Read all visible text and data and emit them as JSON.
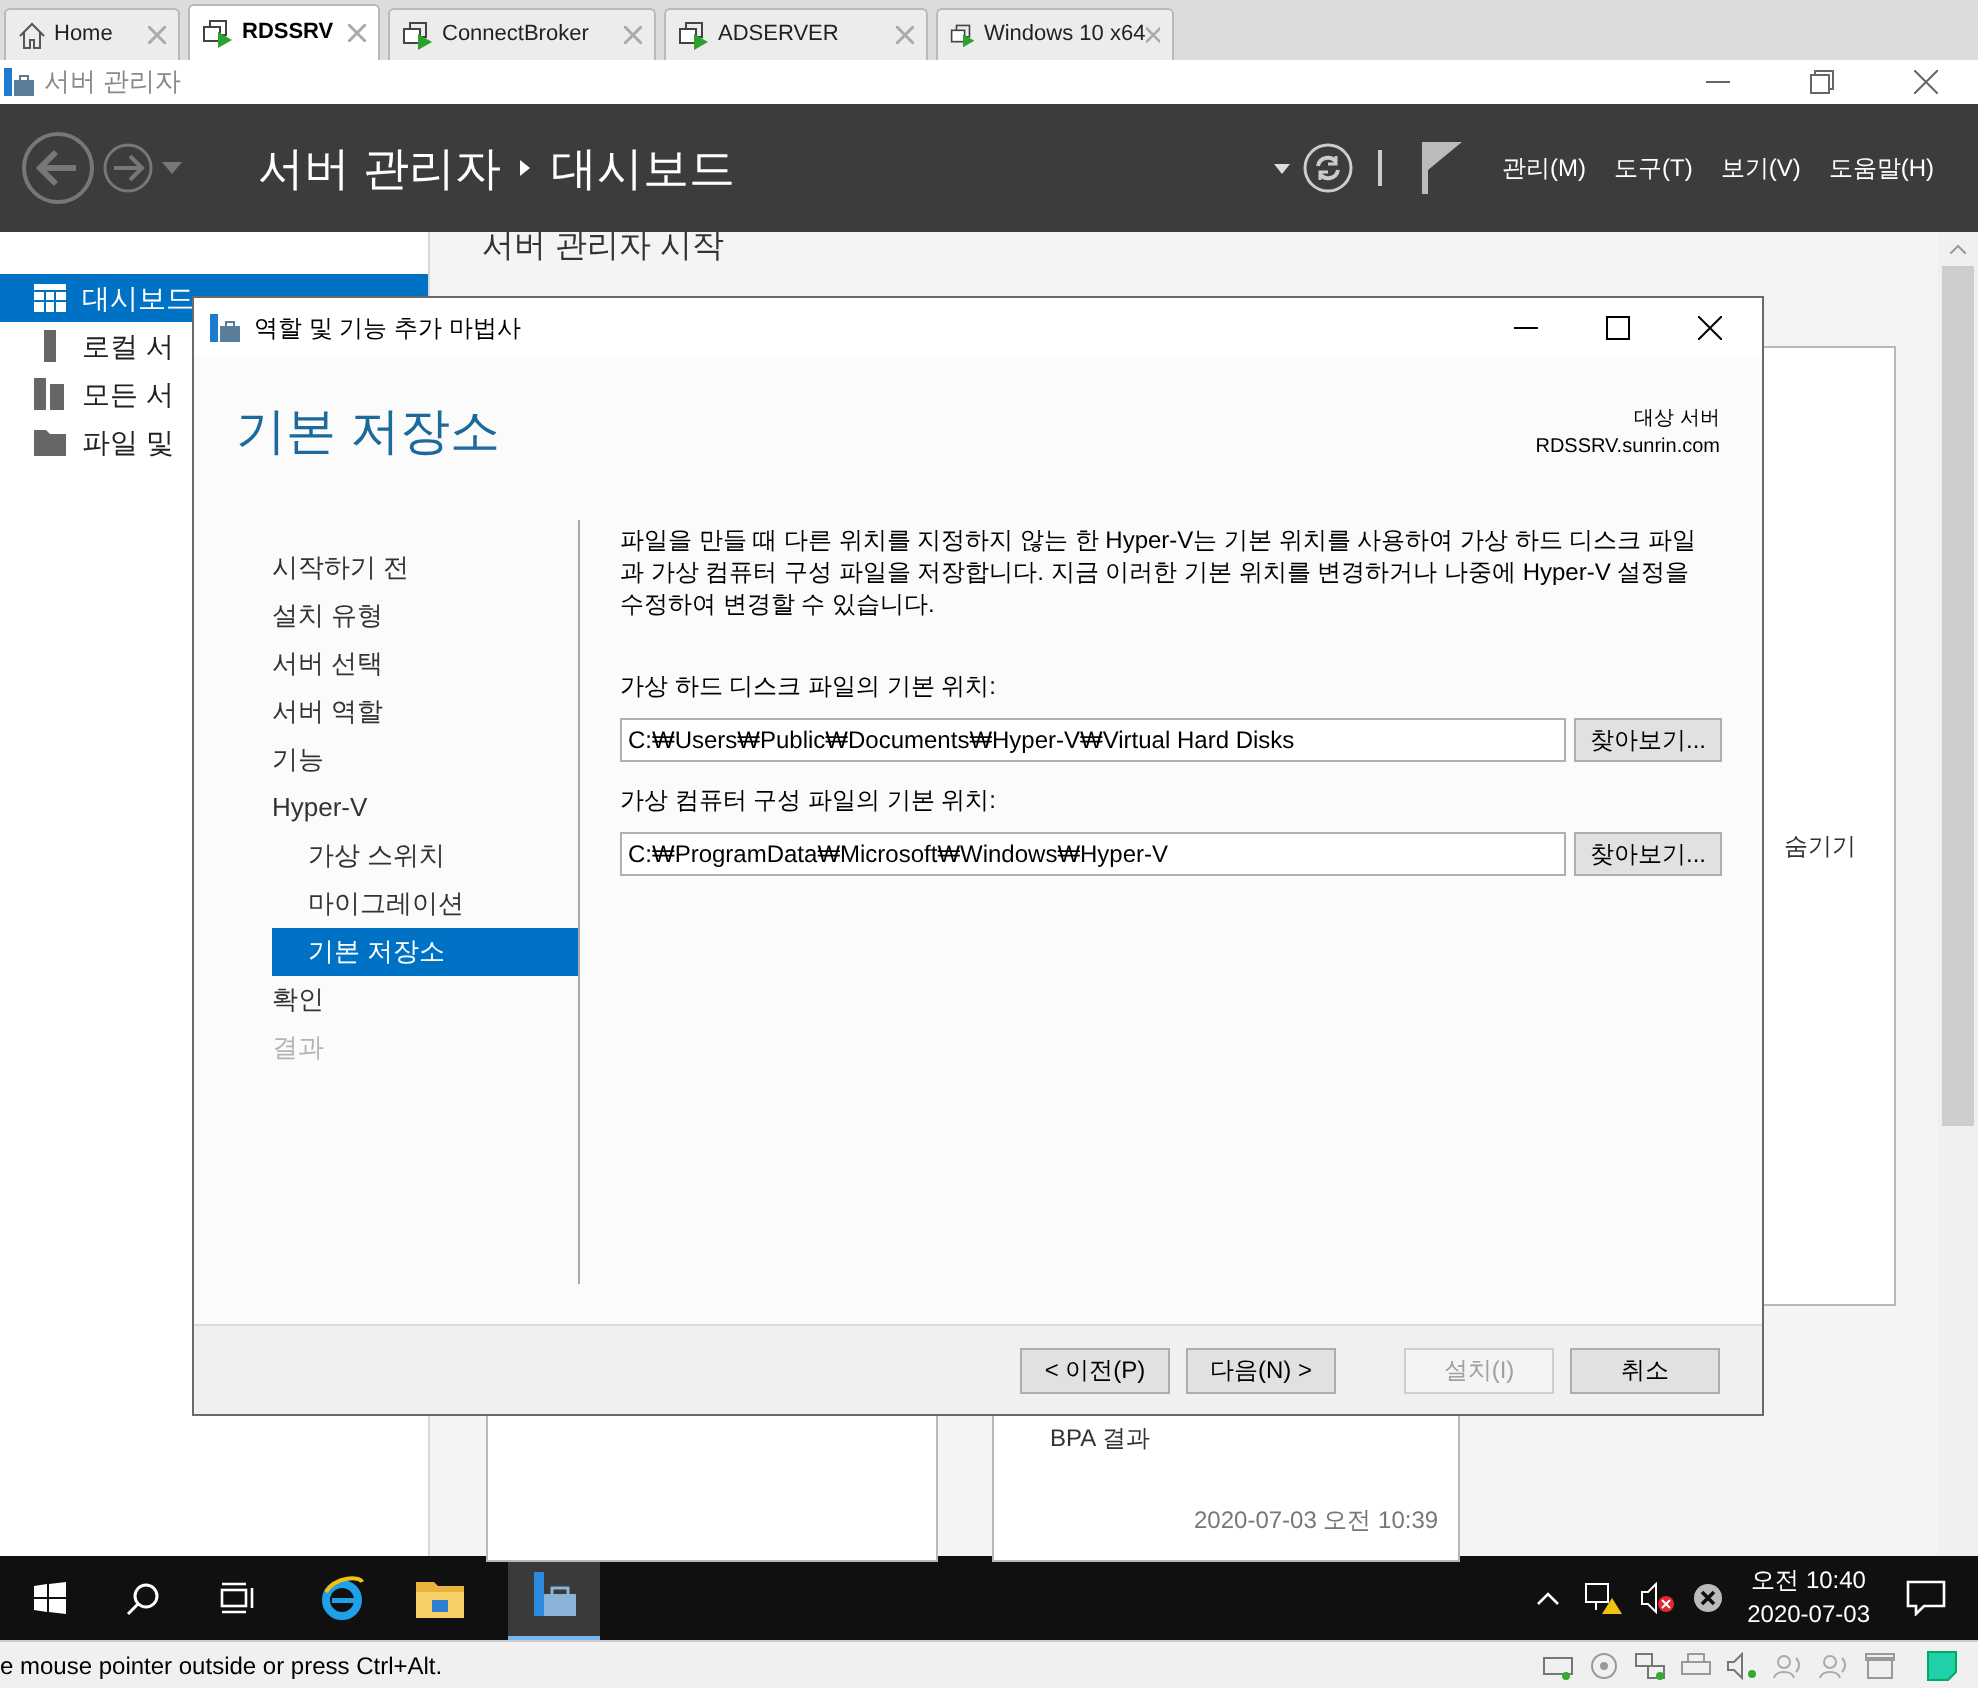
{
  "browser_tabs": [
    {
      "label": "Home",
      "kind": "home",
      "selected": false
    },
    {
      "label": "RDSSRV",
      "kind": "vm",
      "selected": true
    },
    {
      "label": "ConnectBroker",
      "kind": "vm",
      "selected": false
    },
    {
      "label": "ADSERVER",
      "kind": "vm",
      "selected": false
    },
    {
      "label": "Windows 10 x64",
      "kind": "vm",
      "selected": false
    }
  ],
  "window": {
    "title": "서버 관리자"
  },
  "header": {
    "breadcrumb": [
      "서버 관리자",
      "대시보드"
    ],
    "menus": [
      "관리(M)",
      "도구(T)",
      "보기(V)",
      "도움말(H)"
    ]
  },
  "sidebar": {
    "items": [
      {
        "label": "대시보드",
        "kind": "dashboard",
        "selected": true
      },
      {
        "label": "로컬 서",
        "kind": "server",
        "selected": false
      },
      {
        "label": "모든 서",
        "kind": "servers",
        "selected": false
      },
      {
        "label": "파일 및",
        "kind": "files",
        "selected": false
      }
    ]
  },
  "dashboard": {
    "heading": "서버 관리자 시작",
    "hide": "숨기기",
    "bpa": "BPA 결과",
    "timestamp": "2020-07-03 오전 10:39"
  },
  "dialog": {
    "title": "역할 및 기능 추가 마법사",
    "heading": "기본 저장소",
    "target_label": "대상 서버",
    "target_server": "RDSSRV.sunrin.com",
    "steps": [
      {
        "label": "시작하기 전",
        "selected": false,
        "disabled": false
      },
      {
        "label": "설치 유형",
        "selected": false,
        "disabled": false
      },
      {
        "label": "서버 선택",
        "selected": false,
        "disabled": false
      },
      {
        "label": "서버 역할",
        "selected": false,
        "disabled": false
      },
      {
        "label": "기능",
        "selected": false,
        "disabled": false
      },
      {
        "label": "Hyper-V",
        "selected": false,
        "disabled": false,
        "children": [
          {
            "label": "가상 스위치",
            "selected": false,
            "disabled": false
          },
          {
            "label": "마이그레이션",
            "selected": false,
            "disabled": false
          },
          {
            "label": "기본 저장소",
            "selected": true,
            "disabled": false
          }
        ]
      },
      {
        "label": "확인",
        "selected": false,
        "disabled": false
      },
      {
        "label": "결과",
        "selected": false,
        "disabled": true
      }
    ],
    "description": "파일을 만들 때 다른 위치를 지정하지 않는 한 Hyper-V는 기본 위치를 사용하여 가상 하드 디스크 파일과 가상 컴퓨터 구성 파일을 저장합니다. 지금 이러한 기본 위치를 변경하거나 나중에 Hyper-V 설정을 수정하여 변경할 수 있습니다.",
    "fields": [
      {
        "label": "가상 하드 디스크 파일의 기본 위치:",
        "value": "C:₩Users₩Public₩Documents₩Hyper-V₩Virtual Hard Disks",
        "button": "찾아보기..."
      },
      {
        "label": "가상 컴퓨터 구성 파일의 기본 위치:",
        "value": "C:₩ProgramData₩Microsoft₩Windows₩Hyper-V",
        "button": "찾아보기..."
      }
    ],
    "buttons": [
      {
        "label": "< 이전(P)",
        "disabled": false
      },
      {
        "label": "다음(N) >",
        "disabled": false
      },
      {
        "label": "설치(I)",
        "disabled": true
      },
      {
        "label": "취소",
        "disabled": false
      }
    ]
  },
  "taskbar": {
    "time": "오전 10:40",
    "date": "2020-07-03"
  },
  "status_bar": {
    "text": "e mouse pointer outside or press Ctrl+Alt."
  }
}
